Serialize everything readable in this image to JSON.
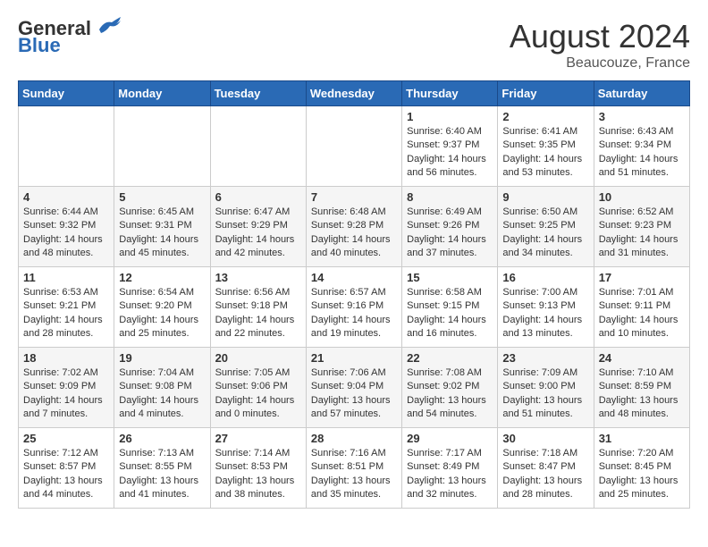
{
  "header": {
    "logo_line1": "General",
    "logo_line2": "Blue",
    "month_year": "August 2024",
    "location": "Beaucouze, France"
  },
  "weekdays": [
    "Sunday",
    "Monday",
    "Tuesday",
    "Wednesday",
    "Thursday",
    "Friday",
    "Saturday"
  ],
  "weeks": [
    [
      {
        "day": "",
        "info": ""
      },
      {
        "day": "",
        "info": ""
      },
      {
        "day": "",
        "info": ""
      },
      {
        "day": "",
        "info": ""
      },
      {
        "day": "1",
        "info": "Sunrise: 6:40 AM\nSunset: 9:37 PM\nDaylight: 14 hours\nand 56 minutes."
      },
      {
        "day": "2",
        "info": "Sunrise: 6:41 AM\nSunset: 9:35 PM\nDaylight: 14 hours\nand 53 minutes."
      },
      {
        "day": "3",
        "info": "Sunrise: 6:43 AM\nSunset: 9:34 PM\nDaylight: 14 hours\nand 51 minutes."
      }
    ],
    [
      {
        "day": "4",
        "info": "Sunrise: 6:44 AM\nSunset: 9:32 PM\nDaylight: 14 hours\nand 48 minutes."
      },
      {
        "day": "5",
        "info": "Sunrise: 6:45 AM\nSunset: 9:31 PM\nDaylight: 14 hours\nand 45 minutes."
      },
      {
        "day": "6",
        "info": "Sunrise: 6:47 AM\nSunset: 9:29 PM\nDaylight: 14 hours\nand 42 minutes."
      },
      {
        "day": "7",
        "info": "Sunrise: 6:48 AM\nSunset: 9:28 PM\nDaylight: 14 hours\nand 40 minutes."
      },
      {
        "day": "8",
        "info": "Sunrise: 6:49 AM\nSunset: 9:26 PM\nDaylight: 14 hours\nand 37 minutes."
      },
      {
        "day": "9",
        "info": "Sunrise: 6:50 AM\nSunset: 9:25 PM\nDaylight: 14 hours\nand 34 minutes."
      },
      {
        "day": "10",
        "info": "Sunrise: 6:52 AM\nSunset: 9:23 PM\nDaylight: 14 hours\nand 31 minutes."
      }
    ],
    [
      {
        "day": "11",
        "info": "Sunrise: 6:53 AM\nSunset: 9:21 PM\nDaylight: 14 hours\nand 28 minutes."
      },
      {
        "day": "12",
        "info": "Sunrise: 6:54 AM\nSunset: 9:20 PM\nDaylight: 14 hours\nand 25 minutes."
      },
      {
        "day": "13",
        "info": "Sunrise: 6:56 AM\nSunset: 9:18 PM\nDaylight: 14 hours\nand 22 minutes."
      },
      {
        "day": "14",
        "info": "Sunrise: 6:57 AM\nSunset: 9:16 PM\nDaylight: 14 hours\nand 19 minutes."
      },
      {
        "day": "15",
        "info": "Sunrise: 6:58 AM\nSunset: 9:15 PM\nDaylight: 14 hours\nand 16 minutes."
      },
      {
        "day": "16",
        "info": "Sunrise: 7:00 AM\nSunset: 9:13 PM\nDaylight: 14 hours\nand 13 minutes."
      },
      {
        "day": "17",
        "info": "Sunrise: 7:01 AM\nSunset: 9:11 PM\nDaylight: 14 hours\nand 10 minutes."
      }
    ],
    [
      {
        "day": "18",
        "info": "Sunrise: 7:02 AM\nSunset: 9:09 PM\nDaylight: 14 hours\nand 7 minutes."
      },
      {
        "day": "19",
        "info": "Sunrise: 7:04 AM\nSunset: 9:08 PM\nDaylight: 14 hours\nand 4 minutes."
      },
      {
        "day": "20",
        "info": "Sunrise: 7:05 AM\nSunset: 9:06 PM\nDaylight: 14 hours\nand 0 minutes."
      },
      {
        "day": "21",
        "info": "Sunrise: 7:06 AM\nSunset: 9:04 PM\nDaylight: 13 hours\nand 57 minutes."
      },
      {
        "day": "22",
        "info": "Sunrise: 7:08 AM\nSunset: 9:02 PM\nDaylight: 13 hours\nand 54 minutes."
      },
      {
        "day": "23",
        "info": "Sunrise: 7:09 AM\nSunset: 9:00 PM\nDaylight: 13 hours\nand 51 minutes."
      },
      {
        "day": "24",
        "info": "Sunrise: 7:10 AM\nSunset: 8:59 PM\nDaylight: 13 hours\nand 48 minutes."
      }
    ],
    [
      {
        "day": "25",
        "info": "Sunrise: 7:12 AM\nSunset: 8:57 PM\nDaylight: 13 hours\nand 44 minutes."
      },
      {
        "day": "26",
        "info": "Sunrise: 7:13 AM\nSunset: 8:55 PM\nDaylight: 13 hours\nand 41 minutes."
      },
      {
        "day": "27",
        "info": "Sunrise: 7:14 AM\nSunset: 8:53 PM\nDaylight: 13 hours\nand 38 minutes."
      },
      {
        "day": "28",
        "info": "Sunrise: 7:16 AM\nSunset: 8:51 PM\nDaylight: 13 hours\nand 35 minutes."
      },
      {
        "day": "29",
        "info": "Sunrise: 7:17 AM\nSunset: 8:49 PM\nDaylight: 13 hours\nand 32 minutes."
      },
      {
        "day": "30",
        "info": "Sunrise: 7:18 AM\nSunset: 8:47 PM\nDaylight: 13 hours\nand 28 minutes."
      },
      {
        "day": "31",
        "info": "Sunrise: 7:20 AM\nSunset: 8:45 PM\nDaylight: 13 hours\nand 25 minutes."
      }
    ]
  ]
}
